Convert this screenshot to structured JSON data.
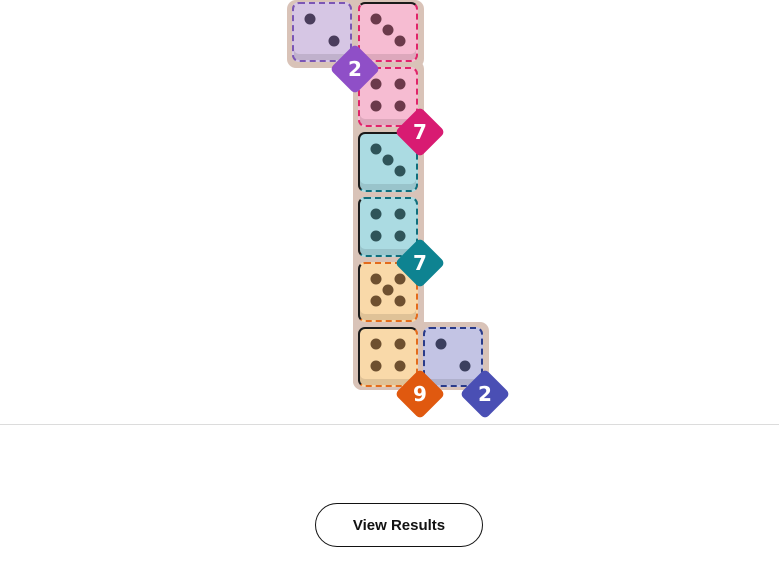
{
  "colors": {
    "purple": {
      "fill": "#d6c6e4",
      "dash": "#7b56b5",
      "pip": "#4a3d5c",
      "badge": "#8f4fc7"
    },
    "pink": {
      "fill": "#f6bcd2",
      "dash": "#e0246a",
      "pip": "#6b3a4b",
      "badge": "#d81b72"
    },
    "teal": {
      "fill": "#abdbe2",
      "dash": "#0f6e7c",
      "pip": "#2f5459",
      "badge": "#0e8391"
    },
    "orange": {
      "fill": "#f9d9a9",
      "dash": "#e46b1b",
      "pip": "#6e5030",
      "badge": "#e0590f"
    },
    "blue": {
      "fill": "#c3c4e4",
      "dash": "#2a3b8a",
      "pip": "#3b3f5e",
      "badge": "#4a4fb4"
    }
  },
  "dice": [
    {
      "color": "purple",
      "value": 2
    },
    {
      "color": "pink",
      "value": 3
    },
    {
      "color": "pink",
      "value": 4
    },
    {
      "color": "teal",
      "value": 3
    },
    {
      "color": "teal",
      "value": 4
    },
    {
      "color": "orange",
      "value": 5
    },
    {
      "color": "orange",
      "value": 4
    },
    {
      "color": "blue",
      "value": 2
    }
  ],
  "badges": [
    {
      "color": "purple",
      "value": "2"
    },
    {
      "color": "pink",
      "value": "7"
    },
    {
      "color": "teal",
      "value": "7"
    },
    {
      "color": "orange",
      "value": "9"
    },
    {
      "color": "blue",
      "value": "2"
    }
  ],
  "footer": {
    "button_label": "View Results"
  }
}
